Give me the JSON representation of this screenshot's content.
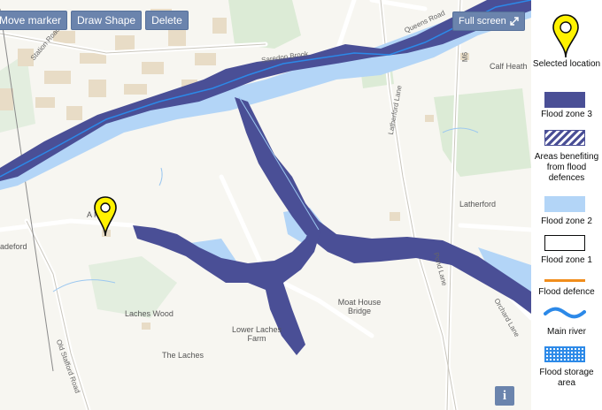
{
  "toolbar": {
    "move_marker": "Move marker",
    "draw_shape": "Draw Shape",
    "delete": "Delete"
  },
  "full_screen": "Full screen",
  "info": "i",
  "map_labels": {
    "calf_heath": "Calf Heath",
    "latherford": "Latherford",
    "laches_wood": "Laches Wood",
    "moat_house_bridge": "Moat House Bridge",
    "lower_laches_farm": "Lower Laches Farm",
    "the_laches": "The Laches",
    "ash_farm": "A   Farm",
    "radeford": "adeford",
    "saredon_brook": "Saredon Brook",
    "station_road": "Station Road",
    "queens_road": "Queens Road",
    "latherford_lane": "Latherford Lane",
    "old_stafford_road": "Old Stafford Road",
    "orchard_lane": "Orchard Lane",
    "pond_lane": "Pond Lane",
    "m6": "M6"
  },
  "legend": {
    "selected_location": "Selected location",
    "flood_zone_3": "Flood zone 3",
    "areas_benefiting": "Areas benefiting from flood defences",
    "flood_zone_2": "Flood zone 2",
    "flood_zone_1": "Flood zone 1",
    "flood_defence": "Flood defence",
    "main_river": "Main river",
    "flood_storage": "Flood storage area"
  },
  "colors": {
    "flood_zone_3": "#4a4f96",
    "flood_zone_2": "#b3d5f7",
    "flood_defence": "#f18d1c",
    "main_river": "#2c89e8",
    "marker": "#fff200",
    "button": "#6b84ad"
  }
}
